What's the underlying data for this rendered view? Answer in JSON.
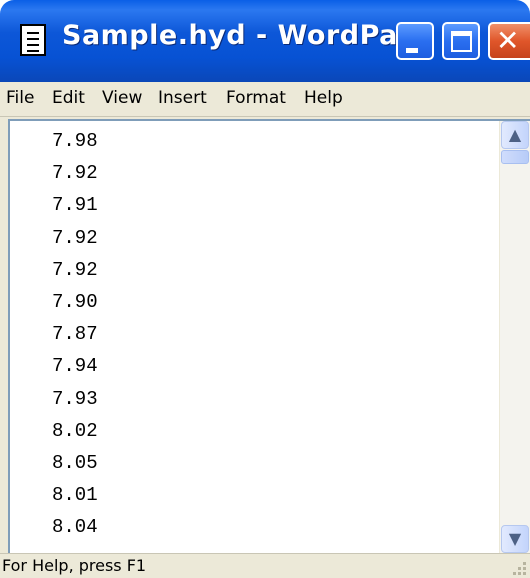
{
  "window": {
    "title": "Sample.hyd - WordPad",
    "icon": "wordpad-document-icon",
    "controls": [
      "minimize-icon",
      "maximize-icon",
      "close-icon"
    ]
  },
  "menu": [
    "File",
    "Edit",
    "View",
    "Insert",
    "Format",
    "Help"
  ],
  "document": {
    "lines": [
      "7.98",
      "7.92",
      "7.91",
      "7.92",
      "7.92",
      "7.90",
      "7.87",
      "7.94",
      "7.93",
      "8.02",
      "8.05",
      "8.01",
      "8.04"
    ]
  },
  "status": {
    "text": "For Help, press F1"
  },
  "colors": {
    "titlebar": "#0752d4",
    "close_button": "#e0562a",
    "chrome": "#ece9d8"
  }
}
